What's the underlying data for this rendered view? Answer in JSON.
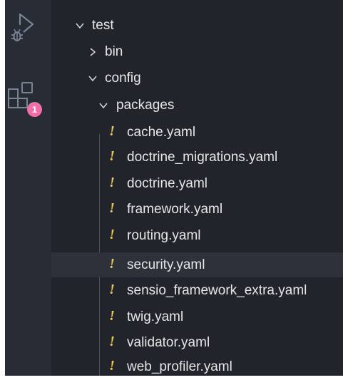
{
  "activity_bar": {
    "items": [
      {
        "name": "run-and-debug",
        "icon": "debug-run-icon"
      },
      {
        "name": "extensions",
        "icon": "extensions-icon",
        "badge": "1"
      }
    ],
    "badge_color": "#f06fa8"
  },
  "explorer": {
    "tree": [
      {
        "label": "test",
        "type": "folder",
        "expanded": true,
        "depth": 0
      },
      {
        "label": "bin",
        "type": "folder",
        "expanded": false,
        "depth": 1
      },
      {
        "label": "config",
        "type": "folder",
        "expanded": true,
        "depth": 1
      },
      {
        "label": "packages",
        "type": "folder",
        "expanded": true,
        "depth": 2
      },
      {
        "label": "cache.yaml",
        "type": "file",
        "icon": "yaml-icon",
        "depth": 3
      },
      {
        "label": "doctrine_migrations.yaml",
        "type": "file",
        "icon": "yaml-icon",
        "depth": 3
      },
      {
        "label": "doctrine.yaml",
        "type": "file",
        "icon": "yaml-icon",
        "depth": 3
      },
      {
        "label": "framework.yaml",
        "type": "file",
        "icon": "yaml-icon",
        "depth": 3
      },
      {
        "label": "routing.yaml",
        "type": "file",
        "icon": "yaml-icon",
        "depth": 3
      },
      {
        "label": "security.yaml",
        "type": "file",
        "icon": "yaml-icon",
        "depth": 3,
        "selected": true
      },
      {
        "label": "sensio_framework_extra.yaml",
        "type": "file",
        "icon": "yaml-icon",
        "depth": 3
      },
      {
        "label": "twig.yaml",
        "type": "file",
        "icon": "yaml-icon",
        "depth": 3
      },
      {
        "label": "validator.yaml",
        "type": "file",
        "icon": "yaml-icon",
        "depth": 3
      },
      {
        "label": "web_profiler.yaml",
        "type": "file",
        "icon": "yaml-icon",
        "depth": 3
      }
    ],
    "yaml_icon_glyph": "!",
    "colors": {
      "background": "#21252b",
      "selected_row": "#2c313a",
      "text": "#e6e6e6",
      "yaml_icon": "#f2c94c"
    }
  }
}
